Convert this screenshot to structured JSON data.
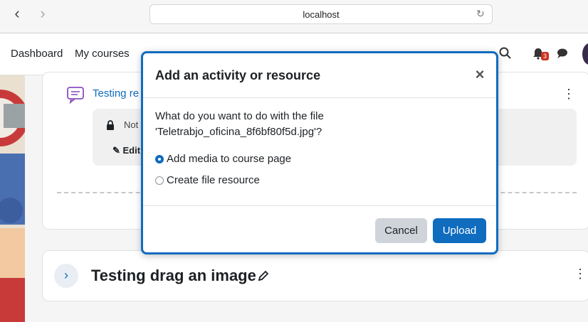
{
  "browser": {
    "url": "localhost"
  },
  "navbar": {
    "links": [
      "Dashboard",
      "My courses"
    ],
    "notification_count": "3"
  },
  "course": {
    "activity_title": "Testing re",
    "restriction_text": "Not a",
    "edit_label": "Edit",
    "section_title": "Testing drag an image"
  },
  "modal": {
    "title": "Add an activity or resource",
    "question": "What do you want to do with the file 'Teletrabjo_oficina_8f6bf80f5d.jpg'?",
    "options": [
      {
        "label": "Add media to course page",
        "selected": true
      },
      {
        "label": "Create file resource",
        "selected": false
      }
    ],
    "cancel_label": "Cancel",
    "upload_label": "Upload"
  },
  "colors": {
    "accent": "#0f6cbf",
    "badge": "#ca3120"
  }
}
